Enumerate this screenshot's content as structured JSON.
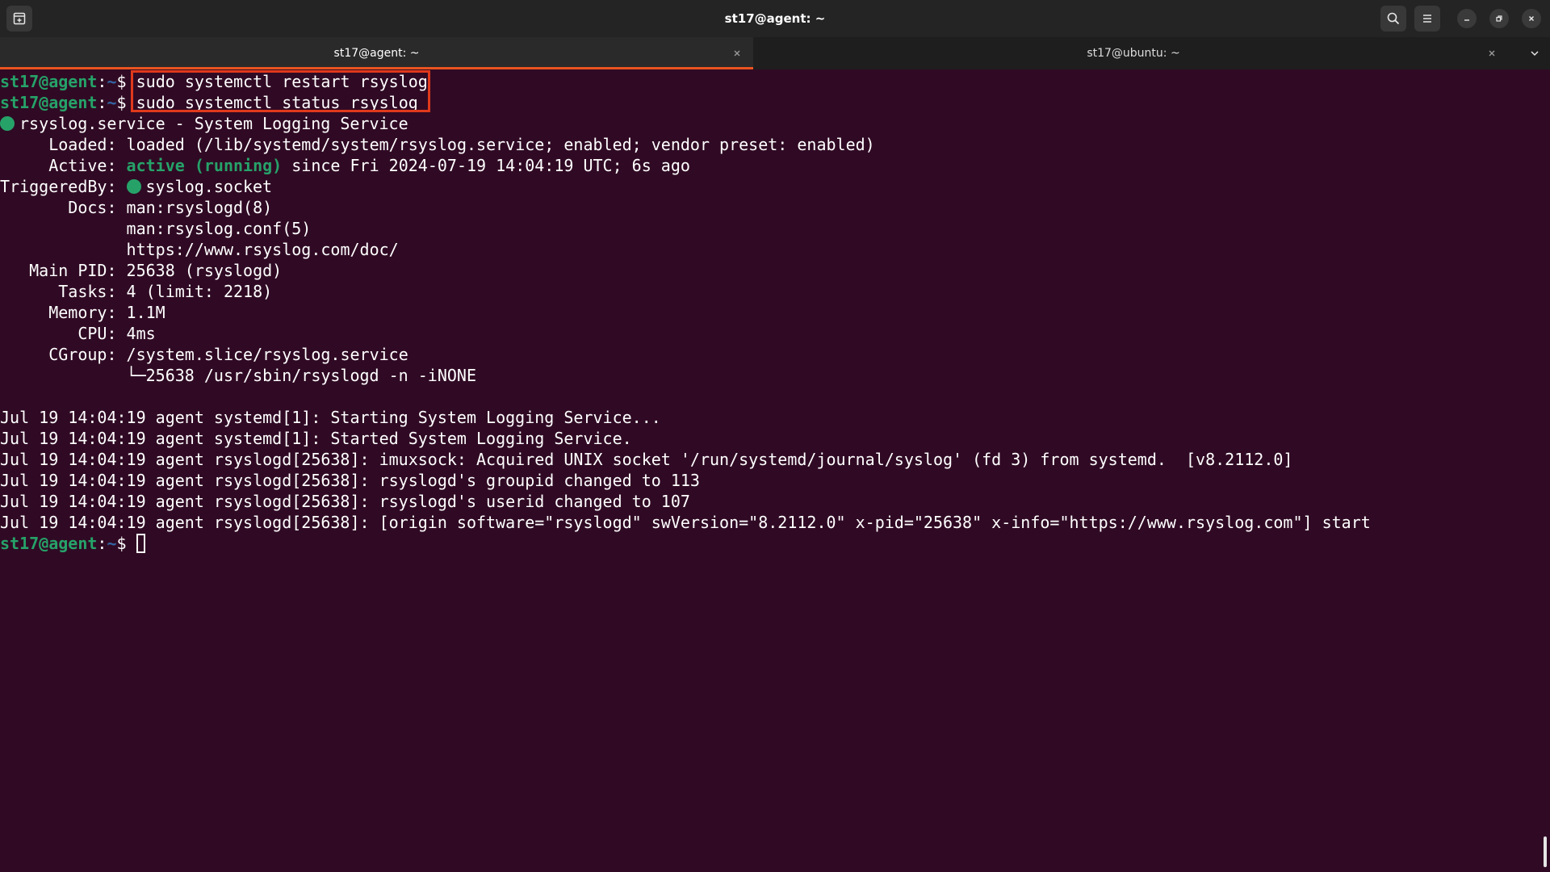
{
  "window": {
    "title": "st17@agent: ~"
  },
  "tabs": [
    {
      "label": "st17@agent: ~",
      "active": true
    },
    {
      "label": "st17@ubuntu: ~",
      "active": false
    }
  ],
  "icons": {
    "new_tab": "new-tab-icon",
    "search": "search-icon",
    "menu": "hamburger-menu-icon",
    "minimize": "minimize-icon",
    "restore": "restore-icon",
    "close": "close-icon",
    "tab_close": "tab-close-icon",
    "tab_list": "chevron-down-icon"
  },
  "colors": {
    "background": "#300a24",
    "prompt_user": "#26a269",
    "prompt_path": "#3465a4",
    "accent": "#e95420",
    "highlight": "#e0391c"
  },
  "terminal": {
    "prompt": {
      "user": "st17@agent",
      "colon": ":",
      "path": "~",
      "dollar": "$ "
    },
    "commands": [
      "sudo systemctl restart rsyslog",
      "sudo systemctl status rsyslog"
    ],
    "service_line": "rsyslog.service - System Logging Service",
    "loaded": {
      "label": "     Loaded: ",
      "value": "loaded (/lib/systemd/system/rsyslog.service; enabled; vendor preset: enabled)"
    },
    "active": {
      "label": "     Active: ",
      "status": "active (running)",
      "rest": " since Fri 2024-07-19 14:04:19 UTC; 6s ago"
    },
    "triggered": {
      "label": "TriggeredBy: ",
      "value": "syslog.socket"
    },
    "docs": {
      "label": "       Docs: ",
      "values": [
        "man:rsyslogd(8)",
        "man:rsyslog.conf(5)",
        "https://www.rsyslog.com/doc/"
      ]
    },
    "docs_indent": "             ",
    "main_pid": {
      "label": "   Main PID: ",
      "value": "25638 (rsyslogd)"
    },
    "tasks": {
      "label": "      Tasks: ",
      "value": "4 (limit: 2218)"
    },
    "memory": {
      "label": "     Memory: ",
      "value": "1.1M"
    },
    "cpu": {
      "label": "        CPU: ",
      "value": "4ms"
    },
    "cgroup": {
      "label": "     CGroup: ",
      "value": "/system.slice/rsyslog.service",
      "child": "             └─25638 /usr/sbin/rsyslogd -n -iNONE"
    },
    "logs": [
      "Jul 19 14:04:19 agent systemd[1]: Starting System Logging Service...",
      "Jul 19 14:04:19 agent systemd[1]: Started System Logging Service.",
      "Jul 19 14:04:19 agent rsyslogd[25638]: imuxsock: Acquired UNIX socket '/run/systemd/journal/syslog' (fd 3) from systemd.  [v8.2112.0]",
      "Jul 19 14:04:19 agent rsyslogd[25638]: rsyslogd's groupid changed to 113",
      "Jul 19 14:04:19 agent rsyslogd[25638]: rsyslogd's userid changed to 107",
      "Jul 19 14:04:19 agent rsyslogd[25638]: [origin software=\"rsyslogd\" swVersion=\"8.2112.0\" x-pid=\"25638\" x-info=\"https://www.rsyslog.com\"] start"
    ]
  }
}
